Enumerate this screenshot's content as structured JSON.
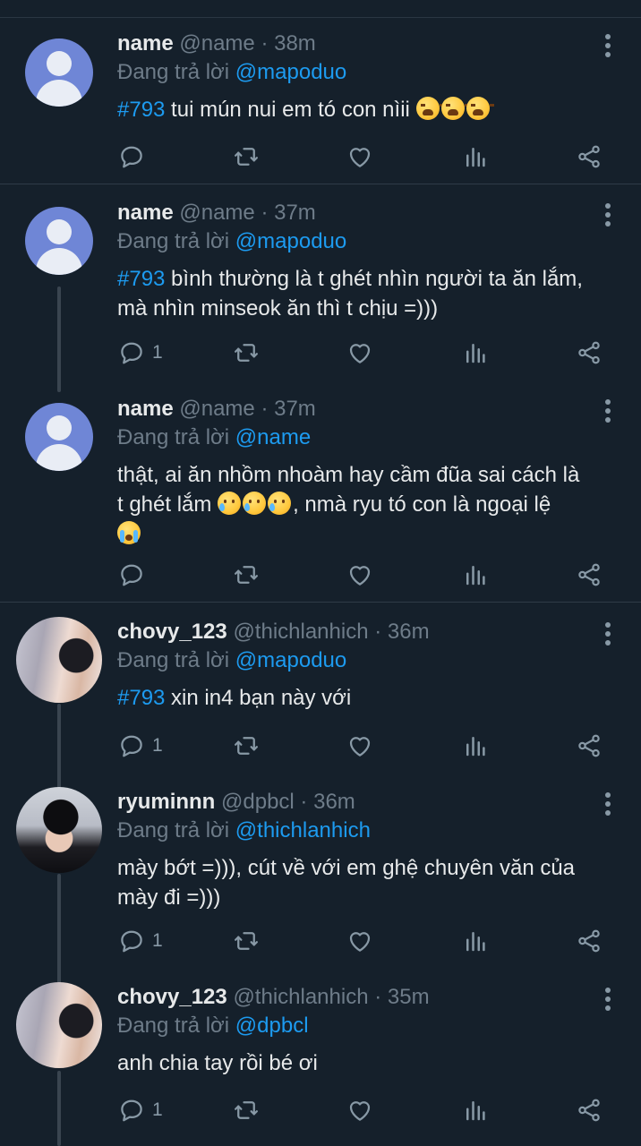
{
  "tweets": [
    {
      "name": "name",
      "handle": "@name",
      "time": "38m",
      "replying_prefix": "Đang trả lời",
      "replying_to": "@mapoduo",
      "hashtag": "#793",
      "text": " tui mún nui em tó con nìii ",
      "emojis": [
        "tired-face-emoji",
        "tired-face-emoji",
        "tired-face-emoji"
      ],
      "reply_count": "",
      "avatar": "default-avatar"
    },
    {
      "name": "name",
      "handle": "@name",
      "time": "37m",
      "replying_prefix": "Đang trả lời",
      "replying_to": "@mapoduo",
      "hashtag": "#793",
      "text_line1": " bình thường là t ghét nhìn người ta ăn lắm,",
      "text_line2": "mà nhìn minseok ăn thì t chịu =)))",
      "reply_count": "1",
      "avatar": "default-avatar"
    },
    {
      "name": "name",
      "handle": "@name",
      "time": "37m",
      "replying_prefix": "Đang trả lời",
      "replying_to": "@name",
      "text_line1": "thật, ai ăn nhồm nhoàm hay cầm đũa sai cách là",
      "text_line2a": "t ghét lắm ",
      "text_line2b": ", nmà ryu tó con là ngoại lệ",
      "emojis": [
        "smiling-tear-emoji",
        "smiling-tear-emoji",
        "smiling-tear-emoji",
        "crying-face-emoji"
      ],
      "reply_count": "",
      "avatar": "default-avatar"
    },
    {
      "name": "chovy_123",
      "handle": "@thichlanhich",
      "time": "36m",
      "replying_prefix": "Đang trả lời",
      "replying_to": "@mapoduo",
      "hashtag": "#793",
      "text": " xin in4 bạn này với",
      "reply_count": "1",
      "avatar": "photo-avatar"
    },
    {
      "name": "ryuminnn",
      "handle": "@dpbcl",
      "time": "36m",
      "replying_prefix": "Đang trả lời",
      "replying_to": "@thichlanhich",
      "text_line1": "mày bớt =))), cút về với em ghệ chuyên văn của",
      "text_line2": "mày đi =)))",
      "reply_count": "1",
      "avatar": "photo-avatar"
    },
    {
      "name": "chovy_123",
      "handle": "@thichlanhich",
      "time": "35m",
      "replying_prefix": "Đang trả lời",
      "replying_to": "@dpbcl",
      "text": "anh chia tay rồi bé ơi",
      "reply_count": "1",
      "avatar": "photo-avatar"
    }
  ],
  "separator": " · ",
  "colors": {
    "background": "#15202b",
    "accent": "#1d9bf0",
    "muted": "#6e7c89",
    "icon": "#8899a6"
  }
}
